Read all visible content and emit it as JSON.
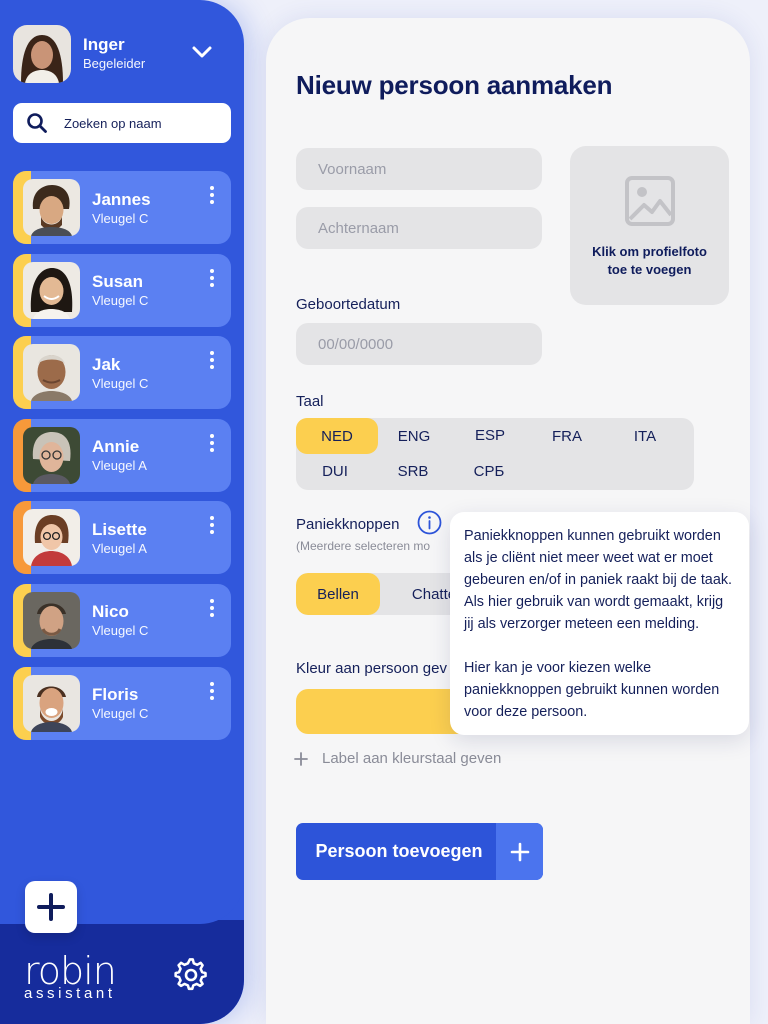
{
  "user": {
    "name": "Inger",
    "role": "Begeleider"
  },
  "search": {
    "placeholder": "Zoeken op naam"
  },
  "clients": [
    {
      "name": "Jannes",
      "ward": "Vleugel C",
      "accent": "#fccf4f"
    },
    {
      "name": "Susan",
      "ward": "Vleugel C",
      "accent": "#fccf4f"
    },
    {
      "name": "Jak",
      "ward": "Vleugel C",
      "accent": "#fccf4f"
    },
    {
      "name": "Annie",
      "ward": "Vleugel A",
      "accent": "#f7993a"
    },
    {
      "name": "Lisette",
      "ward": "Vleugel A",
      "accent": "#f7993a"
    },
    {
      "name": "Nico",
      "ward": "Vleugel C",
      "accent": "#fccf4f"
    },
    {
      "name": "Floris",
      "ward": "Vleugel C",
      "accent": "#fccf4f"
    }
  ],
  "logo": {
    "word": "robin",
    "sub": "assistant"
  },
  "form": {
    "title": "Nieuw persoon aanmaken",
    "firstname_placeholder": "Voornaam",
    "lastname_placeholder": "Achternaam",
    "photo_text": "Klik om profielfoto toe te voegen",
    "birthdate_label": "Geboortedatum",
    "birthdate_placeholder": "00/00/0000",
    "language_label": "Taal",
    "languages": [
      "NED",
      "ENG",
      "ESP",
      "FRA",
      "ITA",
      "DUI",
      "SRB",
      "СРБ"
    ],
    "selected_language": "NED",
    "panic_label": "Paniekknoppen",
    "panic_sub": "(Meerdere selecteren mo",
    "panic_options": [
      "Bellen",
      "Chatte"
    ],
    "color_label": "Kleur aan persoon gev",
    "color_value": "#fccf4f",
    "add_label_text": "Label aan kleurstaal geven",
    "submit_label": "Persoon toevoegen"
  },
  "tooltip": {
    "paragraph1": "Paniekknoppen kunnen gebruikt worden als je cliënt niet meer weet wat er moet gebeuren en/of in paniek raakt bij de taak. Als hier gebruik van wordt gemaakt, krijg jij als verzorger meteen een melding.",
    "paragraph2": "Hier kan je voor kiezen welke paniekknoppen gebruikt kunnen worden voor deze persoon."
  },
  "colors": {
    "sidebar": "#3157dc",
    "card": "#5b80f2",
    "accent_yellow": "#fccf4f",
    "accent_orange": "#f7993a",
    "button": "#2d54d9"
  }
}
